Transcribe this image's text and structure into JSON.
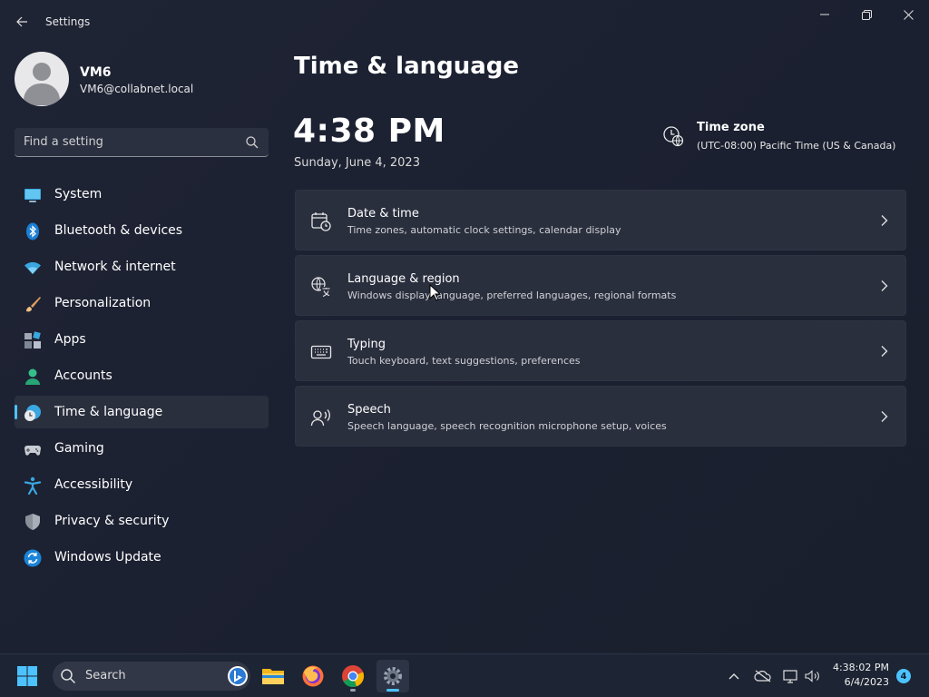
{
  "window": {
    "title": "Settings"
  },
  "profile": {
    "name": "VM6",
    "email": "VM6@collabnet.local"
  },
  "search": {
    "placeholder": "Find a setting"
  },
  "sidebar": {
    "items": [
      {
        "label": "System",
        "icon": "system-icon"
      },
      {
        "label": "Bluetooth & devices",
        "icon": "bluetooth-icon"
      },
      {
        "label": "Network & internet",
        "icon": "wifi-icon"
      },
      {
        "label": "Personalization",
        "icon": "brush-icon"
      },
      {
        "label": "Apps",
        "icon": "apps-icon"
      },
      {
        "label": "Accounts",
        "icon": "accounts-icon"
      },
      {
        "label": "Time & language",
        "icon": "time-language-icon",
        "active": true
      },
      {
        "label": "Gaming",
        "icon": "gamepad-icon"
      },
      {
        "label": "Accessibility",
        "icon": "accessibility-icon"
      },
      {
        "label": "Privacy & security",
        "icon": "shield-icon"
      },
      {
        "label": "Windows Update",
        "icon": "update-icon"
      }
    ]
  },
  "main": {
    "title": "Time & language",
    "clock": {
      "time": "4:38 PM",
      "date": "Sunday, June 4, 2023"
    },
    "timezone": {
      "title": "Time zone",
      "value": "(UTC-08:00) Pacific Time (US & Canada)"
    },
    "cards": [
      {
        "title": "Date & time",
        "subtitle": "Time zones, automatic clock settings, calendar display",
        "icon": "calendar-clock-icon"
      },
      {
        "title": "Language & region",
        "subtitle": "Windows display language, preferred languages, regional formats",
        "icon": "language-icon"
      },
      {
        "title": "Typing",
        "subtitle": "Touch keyboard, text suggestions, preferences",
        "icon": "keyboard-icon"
      },
      {
        "title": "Speech",
        "subtitle": "Speech language, speech recognition microphone setup, voices",
        "icon": "speech-icon"
      }
    ]
  },
  "taskbar": {
    "search_label": "Search",
    "apps": [
      "file-explorer-icon",
      "firefox-icon",
      "chrome-icon",
      "settings-icon"
    ],
    "tray": {
      "time": "4:38:02 PM",
      "date": "6/4/2023",
      "notifications": "4"
    }
  },
  "colors": {
    "accent": "#4cc2ff",
    "background": "#1c2130",
    "card": "#2a2f3e"
  }
}
